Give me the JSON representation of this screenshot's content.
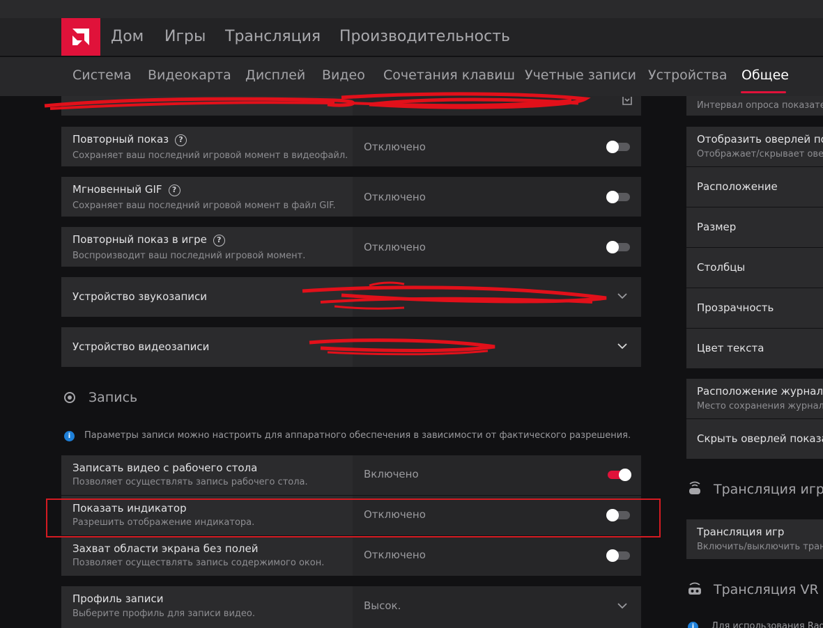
{
  "top_nav": {
    "items": [
      "Дом",
      "Игры",
      "Трансляция",
      "Производительность"
    ]
  },
  "sub_nav": {
    "items": [
      "Система",
      "Видеокарта",
      "Дисплей",
      "Видео",
      "Сочетания клавиш",
      "Учетные записи",
      "Устройства",
      "Общее"
    ],
    "active": "Общее"
  },
  "settings": {
    "replay": {
      "title": "Повторный показ",
      "desc": "Сохраняет ваш последний игровой момент в видеофайл.",
      "value": "Отключено"
    },
    "instant_gif": {
      "title": "Мгновенный GIF",
      "desc": "Сохраняет ваш последний игровой момент в файл GIF.",
      "value": "Отключено"
    },
    "ingame_replay": {
      "title": "Повторный показ в игре",
      "desc": "Воспроизводит ваш последний игровой момент.",
      "value": "Отключено"
    },
    "audio_device": {
      "title": "Устройство звукозаписи"
    },
    "video_device": {
      "title": "Устройство видеозаписи"
    }
  },
  "recording": {
    "section_title": "Запись",
    "info": "Параметры записи можно настроить для аппаратного обеспечения в зависимости от фактического разрешения.",
    "desktop": {
      "title": "Записать видео с рабочего стола",
      "desc": "Позволяет осуществлять запись рабочего стола.",
      "value": "Включено"
    },
    "indicator": {
      "title": "Показать индикатор",
      "desc": "Разрешить отображение индикатора.",
      "value": "Отключено"
    },
    "borderless": {
      "title": "Захват области экрана без полей",
      "desc": "Позволяет осуществлять запись содержимого окон.",
      "value": "Отключено"
    },
    "profile": {
      "title": "Профиль записи",
      "desc": "Выберите профиль для записи видео.",
      "value": "Высок."
    }
  },
  "right_panel": {
    "poll_interval_desc": "Интервал опроса показателе",
    "show_overlay": {
      "title": "Отобразить оверлей показ",
      "desc": "Отображает/скрывает оверл"
    },
    "location": "Расположение",
    "size": "Размер",
    "columns": "Столбцы",
    "transparency": "Прозрачность",
    "text_color": "Цвет текста",
    "log_location": {
      "title": "Расположение журнала п",
      "desc": "Место сохранения журналов"
    },
    "hide_overlay": "Скрыть оверлей показате",
    "game_streaming_section": "Трансляция игр",
    "game_streaming": {
      "title": "Трансляция игр",
      "desc": "Включить/выключить транс"
    },
    "vr_section": "Трансляция VR",
    "vr_info": "Для использования Radeo"
  },
  "colors": {
    "accent": "#e0123a",
    "info": "#1e7fd8",
    "highlight": "#d51b22"
  }
}
